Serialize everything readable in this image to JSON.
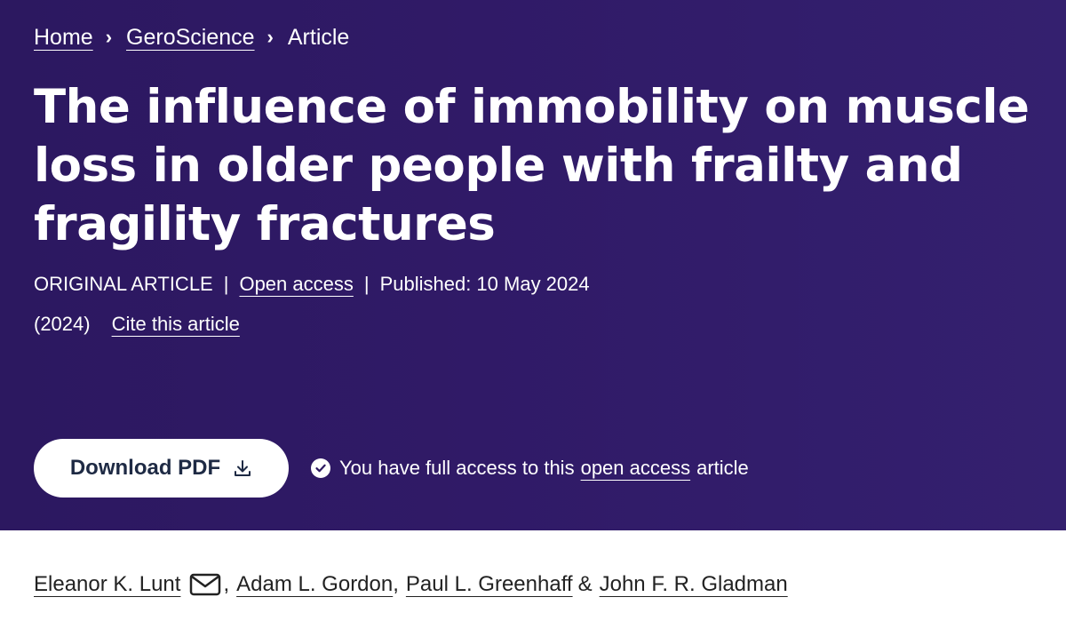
{
  "breadcrumb": {
    "home": "Home",
    "journal": "GeroScience",
    "current": "Article",
    "separator": "›"
  },
  "article": {
    "title": "The influence of immobility on muscle loss in older people with frailty and fragility fractures",
    "type": "ORIGINAL ARTICLE",
    "open_access": "Open access",
    "published": "Published: 10 May 2024",
    "year": "(2024)",
    "cite": "Cite this article"
  },
  "actions": {
    "download_pdf": "Download PDF",
    "access_text": "You have full access to this",
    "access_link": "open access",
    "access_suffix": "article"
  },
  "authors": {
    "list": [
      "Eleanor K. Lunt",
      "Adam L. Gordon",
      "Paul L. Greenhaff",
      "John F. R. Gladman"
    ],
    "comma": ",",
    "ampersand": "&"
  },
  "icons": {
    "download": "download-icon",
    "check": "check-circle-icon",
    "mail": "envelope-icon"
  },
  "colors": {
    "hero_background": "#2c1860",
    "button_text": "#1e2a44",
    "body_text": "#222222"
  }
}
